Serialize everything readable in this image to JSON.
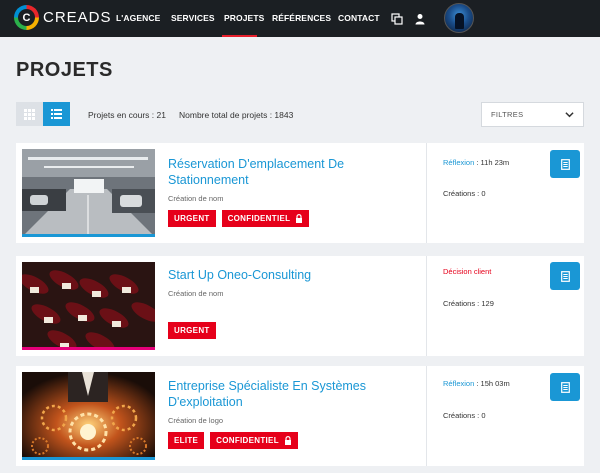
{
  "nav": {
    "logo_letter": "C",
    "brand": "CREADS",
    "items": [
      {
        "label": "L'AGENCE",
        "active": false
      },
      {
        "label": "SERVICES",
        "active": false
      },
      {
        "label": "PROJETS",
        "active": true
      },
      {
        "label": "RÉFÉRENCES",
        "active": false
      },
      {
        "label": "CONTACT",
        "active": false
      }
    ],
    "icons": [
      "copy-icon",
      "user-icon"
    ],
    "accent": "#e61e2b"
  },
  "page": {
    "title": "PROJETS",
    "stats": {
      "in_progress": "Projets en cours : 21",
      "total": "Nombre total de projets : 1843"
    },
    "filters_label": "FILTRES"
  },
  "projects": [
    {
      "title": "Réservation D'emplacement De Stationnement",
      "subtitle": "Création de nom",
      "badges": [
        {
          "label": "URGENT",
          "locked": false
        },
        {
          "label": "CONFIDENTIEL",
          "locked": true
        }
      ],
      "status_label": "Réflexion",
      "status_value": " : 11h 23m",
      "status_color": "#1a97d5",
      "creations": "Créations : 0",
      "thumb_bar_color": "#1a97d5",
      "thumb": "parking-garage-image"
    },
    {
      "title": "Start Up Oneo-Consulting",
      "subtitle": "Création de nom",
      "badges": [
        {
          "label": "URGENT",
          "locked": false
        }
      ],
      "status_label": "Décision client",
      "status_value": "",
      "status_color": "#e6001a",
      "creations": "Créations : 129",
      "thumb_bar_color": "#e6007a",
      "thumb": "wine-bottles-image"
    },
    {
      "title": "Entreprise Spécialiste En Systèmes D'exploitation",
      "subtitle": "Création de logo",
      "badges": [
        {
          "label": "ELITE",
          "locked": false
        },
        {
          "label": "CONFIDENTIEL",
          "locked": true
        }
      ],
      "status_label": "Réflexion",
      "status_value": " : 15h 03m",
      "status_color": "#1a97d5",
      "creations": "Créations : 0",
      "thumb_bar_color": "#1a97d5",
      "thumb": "businessman-gears-image"
    }
  ]
}
